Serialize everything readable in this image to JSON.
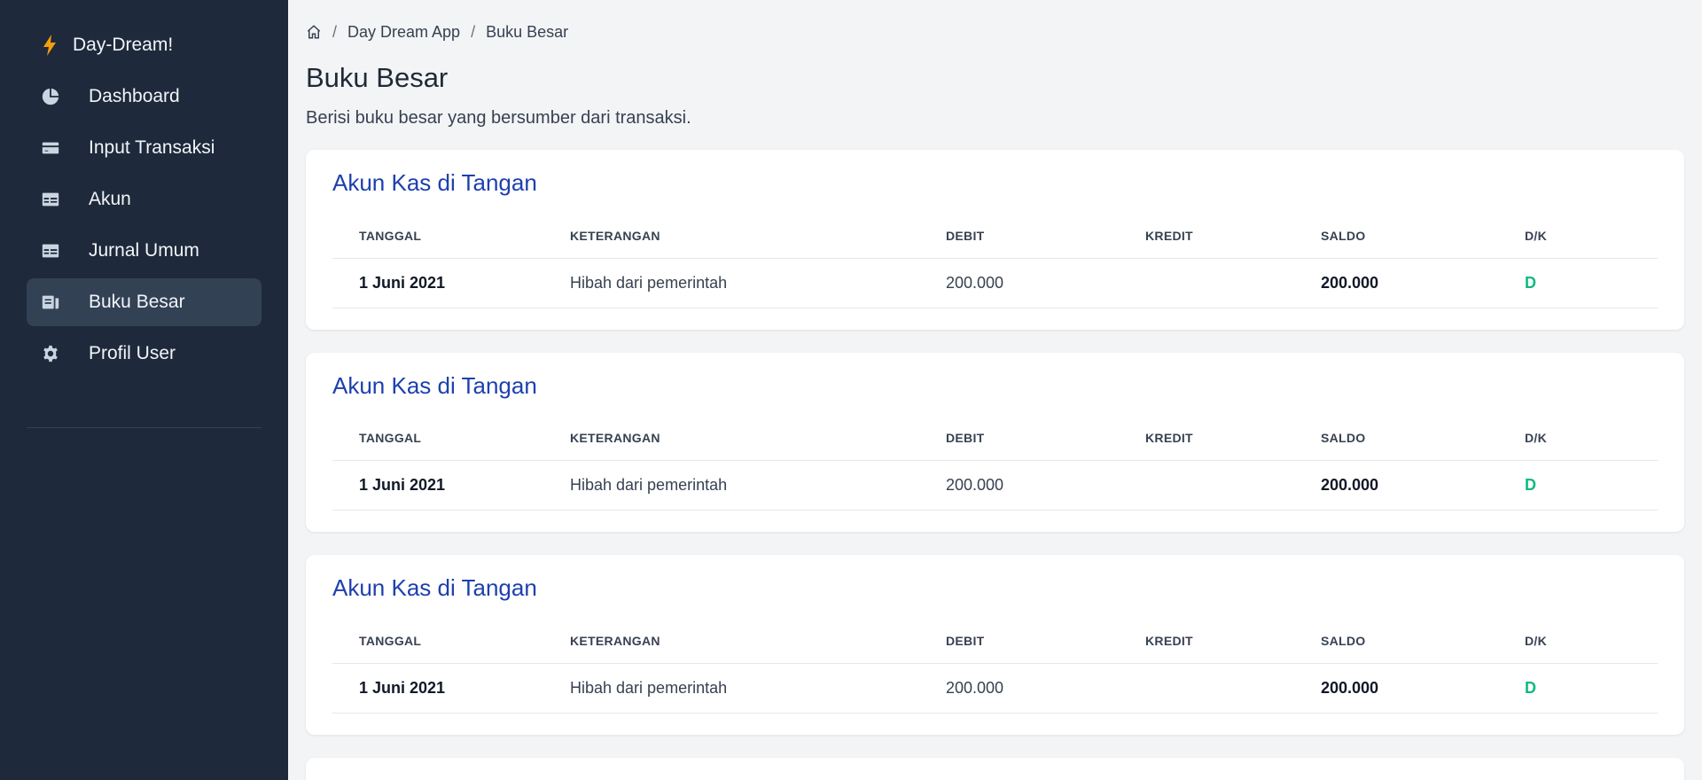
{
  "app": {
    "brand": "Day-Dream!"
  },
  "sidebar": {
    "items": [
      {
        "label": "Dashboard",
        "icon": "pie-chart-icon"
      },
      {
        "label": "Input Transaksi",
        "icon": "credit-card-icon"
      },
      {
        "label": "Akun",
        "icon": "table-icon"
      },
      {
        "label": "Jurnal Umum",
        "icon": "table-icon"
      },
      {
        "label": "Buku Besar",
        "icon": "ledger-icon",
        "active": true
      },
      {
        "label": "Profil User",
        "icon": "gear-icon"
      }
    ]
  },
  "breadcrumb": {
    "items": [
      "Day Dream App",
      "Buku Besar"
    ],
    "separator": "/"
  },
  "page": {
    "title": "Buku Besar",
    "description": "Berisi buku besar yang bersumber dari transaksi."
  },
  "table_headers": [
    "TANGGAL",
    "KETERANGAN",
    "DEBIT",
    "KREDIT",
    "SALDO",
    "D/K"
  ],
  "ledgers": [
    {
      "title": "Akun Kas di Tangan",
      "rows": [
        {
          "tanggal": "1 Juni 2021",
          "keterangan": "Hibah dari pemerintah",
          "debit": "200.000",
          "kredit": "",
          "saldo": "200.000",
          "dk": "D"
        }
      ]
    },
    {
      "title": "Akun Kas di Tangan",
      "rows": [
        {
          "tanggal": "1 Juni 2021",
          "keterangan": "Hibah dari pemerintah",
          "debit": "200.000",
          "kredit": "",
          "saldo": "200.000",
          "dk": "D"
        }
      ]
    },
    {
      "title": "Akun Kas di Tangan",
      "rows": [
        {
          "tanggal": "1 Juni 2021",
          "keterangan": "Hibah dari pemerintah",
          "debit": "200.000",
          "kredit": "",
          "saldo": "200.000",
          "dk": "D"
        }
      ]
    }
  ],
  "colors": {
    "sidebar_bg": "#1e293b",
    "active_bg": "#334155",
    "accent": "#1e40af",
    "dk_color": "#10b981",
    "bolt": "#f59e0b"
  }
}
